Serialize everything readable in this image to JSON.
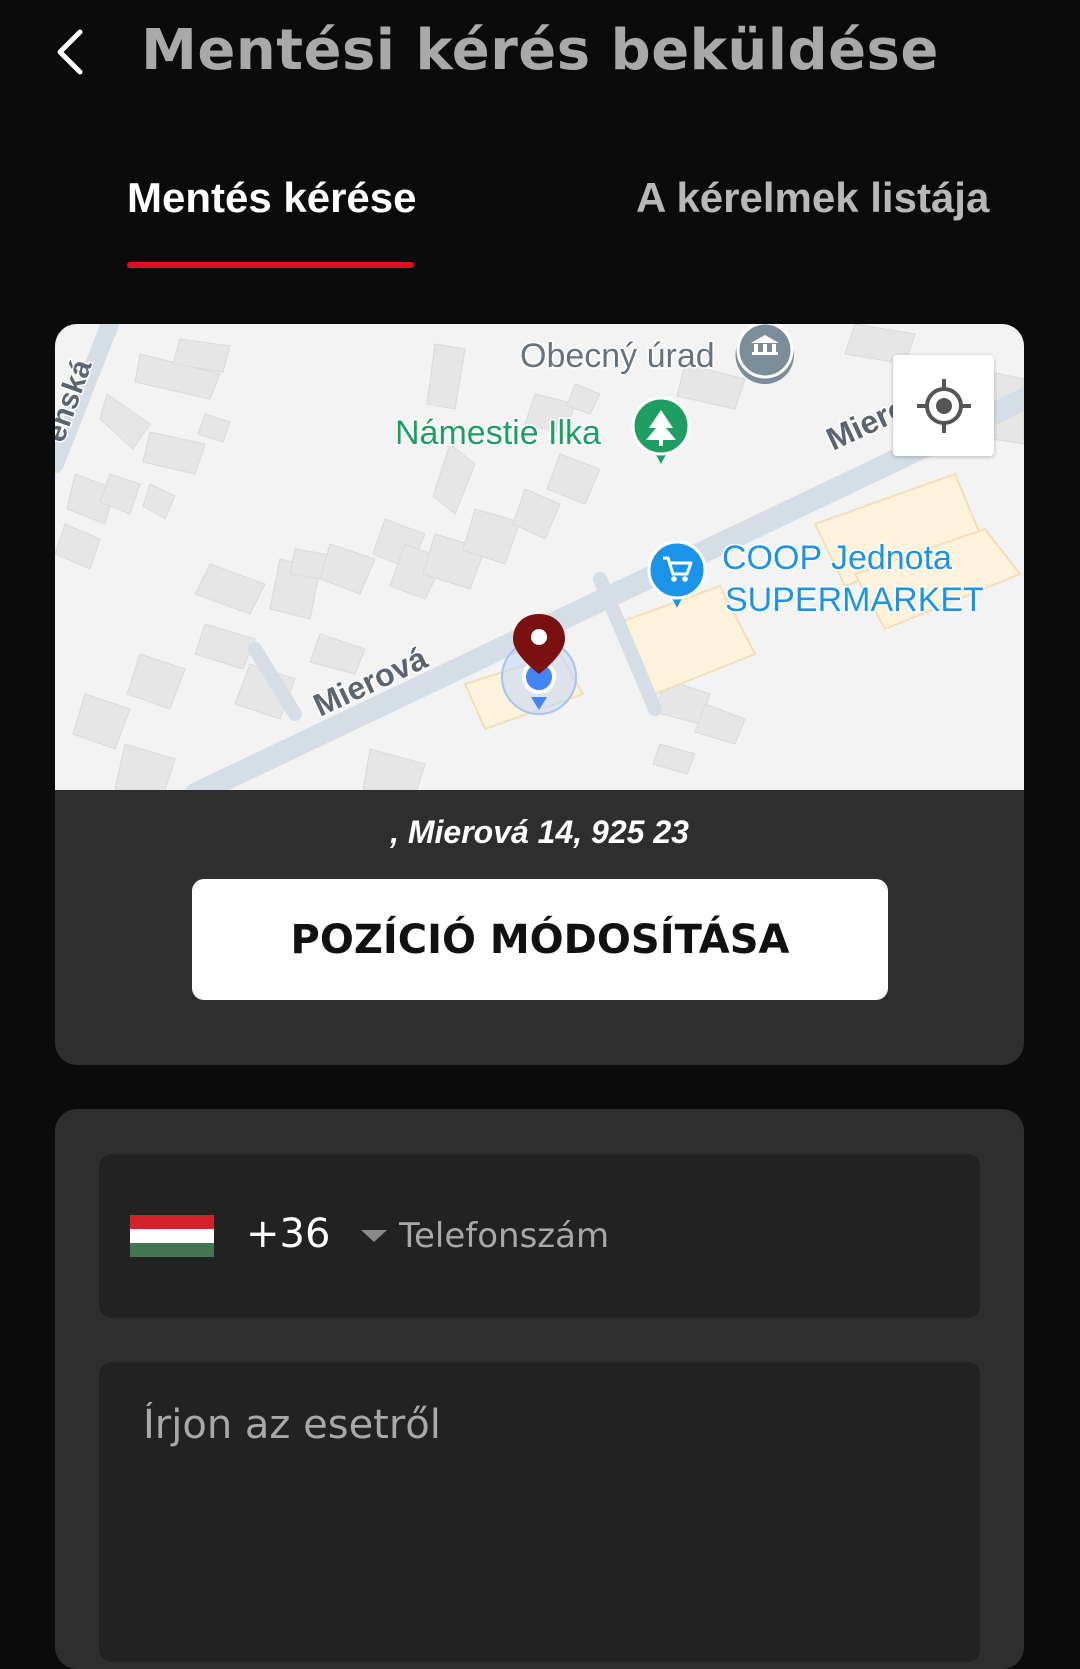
{
  "header": {
    "title": "Mentési kérés beküldése",
    "back_icon": "chevron-left-icon"
  },
  "tabs": [
    {
      "label": "Mentés kérése",
      "active": true
    },
    {
      "label": "A kérelmek listája",
      "active": false
    }
  ],
  "map": {
    "street_labels": [
      "Mierová",
      "Mierová",
      "enská"
    ],
    "poi": [
      {
        "name": "Obecný úrad",
        "icon": "government-building-icon",
        "color": "#7b8d99"
      },
      {
        "name": "Námestie Ilka",
        "icon": "tree-icon",
        "color": "#1e9e62"
      },
      {
        "name_lines": [
          "COOP Jednota",
          "SUPERMARKET"
        ],
        "icon": "shopping-cart-icon",
        "color": "#1a94e9"
      }
    ],
    "locate_icon": "crosshair-icon"
  },
  "location": {
    "address": ", Mierová 14, 925 23",
    "change_button_label": "POZÍCIÓ MÓDOSÍTÁSA"
  },
  "form": {
    "country_flag": "hungary-flag-icon",
    "dial_code": "+36",
    "phone_placeholder": "Telefonszám",
    "description_placeholder": "Írjon az esetről"
  },
  "colors": {
    "background": "#0b0b0b",
    "card": "#2e2e2e",
    "field": "#222222",
    "accent_red": "#e0111a",
    "pin": "#7a1010",
    "user_location": "#4285f4"
  }
}
